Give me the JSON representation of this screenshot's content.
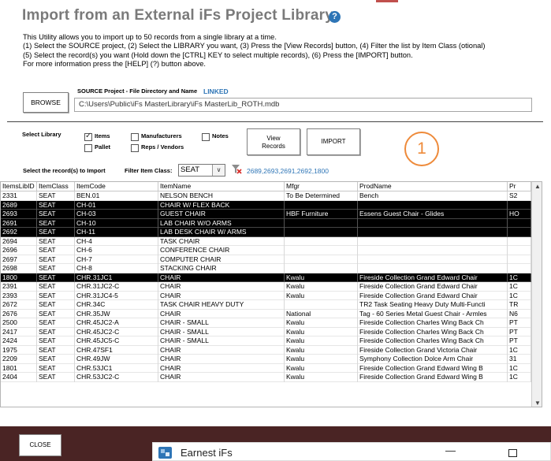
{
  "header": {
    "title": "Import from an External iFs Project Library",
    "help_glyph": "?"
  },
  "instructions": [
    "This Utility allows you to import up to 50 records from a single library at a time.",
    "(1) Select the SOURCE project, (2) Select the LIBRARY you want, (3) Press the [View Records] button, (4) Filter the list by Item Class (otional)",
    "(5) Select the record(s) you want (Hold down the [CTRL] KEY to select multiple records), (6) Press the [IMPORT] button.",
    "For more information press the [HELP] (?) button above."
  ],
  "source": {
    "browse_label": "BROWSE",
    "label": "SOURCE Project - File Directory and Name",
    "status": "LINKED",
    "path": "C:\\Users\\Public\\iFs MasterLibrary\\iFs MasterLib_ROTH.mdb"
  },
  "library": {
    "label": "Select Library",
    "options": {
      "items": {
        "label": "Items",
        "checked": true
      },
      "pallet": {
        "label": "Pallet",
        "checked": false
      },
      "manufacturers": {
        "label": "Manufacturers",
        "checked": false
      },
      "reps": {
        "label": "Reps / Vendors",
        "checked": false
      },
      "notes": {
        "label": "Notes",
        "checked": false
      }
    },
    "view_records_line1": "View",
    "view_records_line2": "Records",
    "import_label": "IMPORT"
  },
  "step_marker": "1",
  "records": {
    "label": "Select the record(s) to Import",
    "filter_label": "Filter Item Class:",
    "filter_value": "SEAT",
    "dropdown_glyph": "∨",
    "selected_ids": "2689,2693,2691,2692,1800"
  },
  "grid": {
    "columns": [
      "ItemsLibID",
      "ItemClass",
      "ItemCode",
      "ItemName",
      "Mfgr",
      "ProdName",
      "Pr"
    ],
    "rows": [
      {
        "cells": [
          "2331",
          "SEAT",
          "BEN.01",
          "NELSON BENCH",
          "To Be Determined",
          "Bench",
          "S2"
        ],
        "selected": false
      },
      {
        "cells": [
          "2689",
          "SEAT",
          "CH-01",
          "CHAIR W/ FLEX BACK",
          "",
          "",
          ""
        ],
        "selected": true
      },
      {
        "cells": [
          "2693",
          "SEAT",
          "CH-03",
          "GUEST CHAIR",
          "HBF Furniture",
          "Essens Guest Chair - Glides",
          "HO"
        ],
        "selected": true
      },
      {
        "cells": [
          "2691",
          "SEAT",
          "CH-10",
          "LAB CHAIR W/O ARMS",
          "",
          "",
          ""
        ],
        "selected": true
      },
      {
        "cells": [
          "2692",
          "SEAT",
          "CH-11",
          "LAB DESK CHAIR W/ ARMS",
          "",
          "",
          ""
        ],
        "selected": true
      },
      {
        "cells": [
          "2694",
          "SEAT",
          "CH-4",
          "TASK CHAIR",
          "",
          "",
          ""
        ],
        "selected": false
      },
      {
        "cells": [
          "2696",
          "SEAT",
          "CH-6",
          "CONFERENCE CHAIR",
          "",
          "",
          ""
        ],
        "selected": false
      },
      {
        "cells": [
          "2697",
          "SEAT",
          "CH-7",
          "COMPUTER CHAIR",
          "",
          "",
          ""
        ],
        "selected": false
      },
      {
        "cells": [
          "2698",
          "SEAT",
          "CH-8",
          "STACKING CHAIR",
          "",
          "",
          ""
        ],
        "selected": false
      },
      {
        "cells": [
          "1800",
          "SEAT",
          "CHR.31JC1",
          "CHAIR",
          "Kwalu",
          "Fireside Collection Grand Edward Chair",
          "1C"
        ],
        "selected": true
      },
      {
        "cells": [
          "2391",
          "SEAT",
          "CHR.31JC2-C",
          "CHAIR",
          "Kwalu",
          "Fireside Collection Grand Edward Chair",
          "1C"
        ],
        "selected": false
      },
      {
        "cells": [
          "2393",
          "SEAT",
          "CHR.31JC4-5",
          "CHAIR",
          "Kwalu",
          "Fireside Collection Grand Edward Chair",
          "1C"
        ],
        "selected": false
      },
      {
        "cells": [
          "2672",
          "SEAT",
          "CHR.34C",
          "TASK CHAIR HEAVY DUTY",
          "",
          "TR2 Task Seating Heavy Duty Multi-Functi",
          "TR"
        ],
        "selected": false
      },
      {
        "cells": [
          "2676",
          "SEAT",
          "CHR.35JW",
          "CHAIR",
          "National",
          "Tag - 60 Series Metal Guest Chair - Armles",
          "N6"
        ],
        "selected": false
      },
      {
        "cells": [
          "2500",
          "SEAT",
          "CHR.45JC2-A",
          "CHAIR - SMALL",
          "Kwalu",
          "Fireside Collection Charles Wing Back Ch",
          "PT"
        ],
        "selected": false
      },
      {
        "cells": [
          "2417",
          "SEAT",
          "CHR.45JC2-C",
          "CHAIR - SMALL",
          "Kwalu",
          "Fireside Collection Charles Wing Back Ch",
          "PT"
        ],
        "selected": false
      },
      {
        "cells": [
          "2424",
          "SEAT",
          "CHR.45JC5-C",
          "CHAIR - SMALL",
          "Kwalu",
          "Fireside Collection Charles Wing Back Ch",
          "PT"
        ],
        "selected": false
      },
      {
        "cells": [
          "1975",
          "SEAT",
          "CHR.47SF1",
          "CHAIR",
          "Kwalu",
          "Fireside Collection Grand Victoria Chair",
          "1C"
        ],
        "selected": false
      },
      {
        "cells": [
          "2209",
          "SEAT",
          "CHR.49JW",
          "CHAIR",
          "Kwalu",
          "Symphony Collection Dolce Arm Chair",
          "31"
        ],
        "selected": false
      },
      {
        "cells": [
          "1801",
          "SEAT",
          "CHR.53JC1",
          "CHAIR",
          "Kwalu",
          "Fireside Collection Grand Edward Wing B",
          "1C"
        ],
        "selected": false
      },
      {
        "cells": [
          "2404",
          "SEAT",
          "CHR.53JC2-C",
          "CHAIR",
          "Kwalu",
          "Fireside Collection Grand Edward Wing B",
          "1C"
        ],
        "selected": false
      }
    ]
  },
  "footer": {
    "close_label": "CLOSE",
    "background_color": "#4a2424"
  },
  "popup": {
    "title": "Earnest iFs",
    "minimize_glyph": "—"
  },
  "colors": {
    "accent_blue": "#2e75b6",
    "step_orange": "#ee8a3a"
  }
}
